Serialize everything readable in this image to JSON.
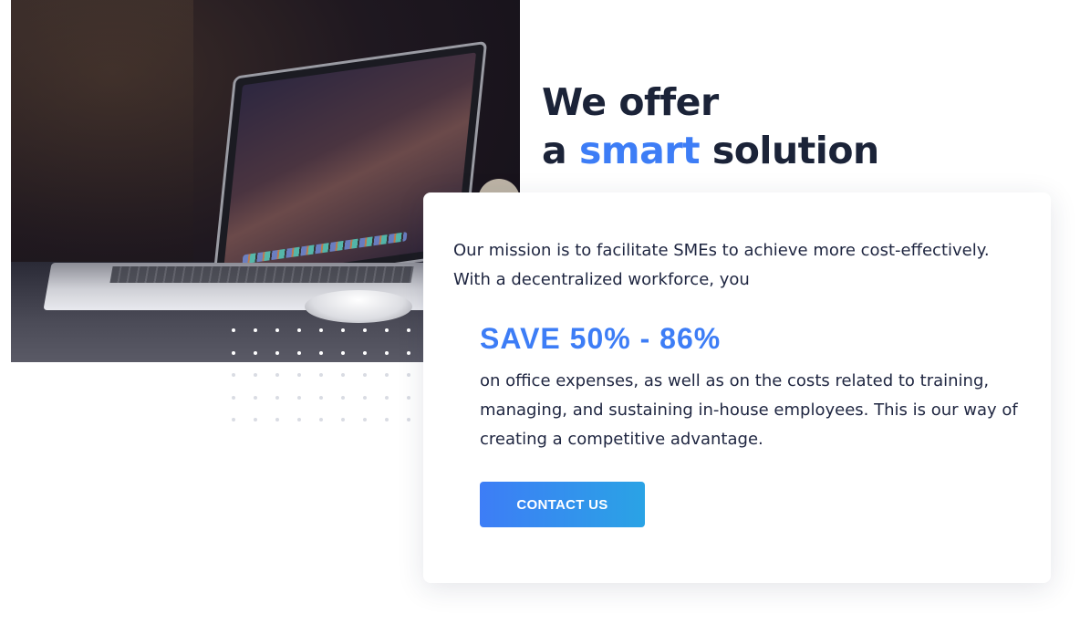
{
  "hero": {
    "heading_line1": "We offer",
    "heading_prefix": "a ",
    "heading_accent": "smart",
    "heading_suffix": " solution"
  },
  "card": {
    "mission_text": "Our mission is to facilitate SMEs to achieve more cost-effectively. With a decentralized workforce, you",
    "save_text": "SAVE 50% - 86%",
    "expenses_text": "on office expenses, as well as on the costs related to training, managing, and sustaining in-house employees. This is our way of creating a competitive advantage.",
    "cta_label": "CONTACT US"
  },
  "colors": {
    "accent": "#3d7df6",
    "heading": "#1b2338",
    "body_text": "#1e2540",
    "button_gradient_start": "#3d7df6",
    "button_gradient_end": "#2aa3e5"
  }
}
